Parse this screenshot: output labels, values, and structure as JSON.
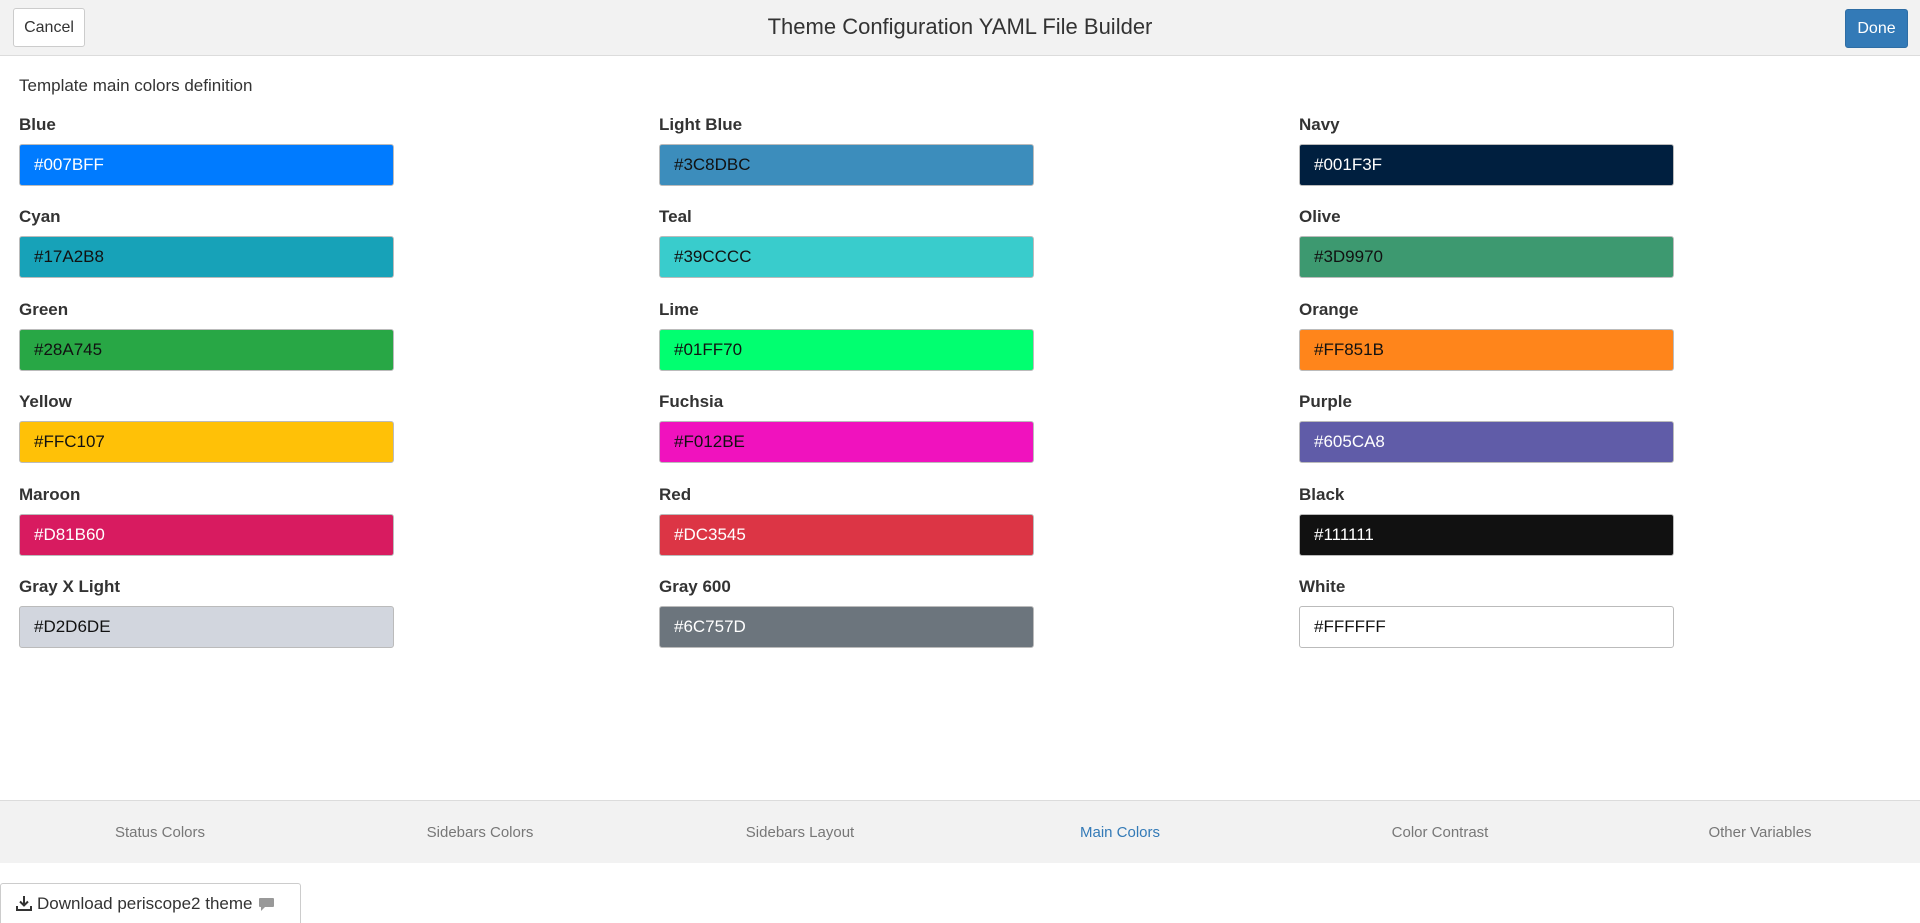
{
  "header": {
    "title": "Theme Configuration YAML File Builder",
    "cancel_label": "Cancel",
    "done_label": "Done"
  },
  "section": {
    "title": "Template main colors definition"
  },
  "colors": [
    {
      "label": "Blue",
      "value": "#007BFF",
      "bg": "#007BFF",
      "fg": "#FFFFFF"
    },
    {
      "label": "Light Blue",
      "value": "#3C8DBC",
      "bg": "#3C8DBC",
      "fg": "#111111"
    },
    {
      "label": "Navy",
      "value": "#001F3F",
      "bg": "#001F3F",
      "fg": "#FFFFFF"
    },
    {
      "label": "Cyan",
      "value": "#17A2B8",
      "bg": "#17A2B8",
      "fg": "#111111"
    },
    {
      "label": "Teal",
      "value": "#39CCCC",
      "bg": "#39CCCC",
      "fg": "#111111"
    },
    {
      "label": "Olive",
      "value": "#3D9970",
      "bg": "#3D9970",
      "fg": "#111111"
    },
    {
      "label": "Green",
      "value": "#28A745",
      "bg": "#28A745",
      "fg": "#111111"
    },
    {
      "label": "Lime",
      "value": "#01FF70",
      "bg": "#01FF70",
      "fg": "#111111"
    },
    {
      "label": "Orange",
      "value": "#FF851B",
      "bg": "#FF851B",
      "fg": "#111111"
    },
    {
      "label": "Yellow",
      "value": "#FFC107",
      "bg": "#FFC107",
      "fg": "#111111"
    },
    {
      "label": "Fuchsia",
      "value": "#F012BE",
      "bg": "#F012BE",
      "fg": "#111111"
    },
    {
      "label": "Purple",
      "value": "#605CA8",
      "bg": "#605CA8",
      "fg": "#FFFFFF"
    },
    {
      "label": "Maroon",
      "value": "#D81B60",
      "bg": "#D81B60",
      "fg": "#FFFFFF"
    },
    {
      "label": "Red",
      "value": "#DC3545",
      "bg": "#DC3545",
      "fg": "#FFFFFF"
    },
    {
      "label": "Black",
      "value": "#111111",
      "bg": "#111111",
      "fg": "#FFFFFF"
    },
    {
      "label": "Gray X Light",
      "value": "#D2D6DE",
      "bg": "#D2D6DE",
      "fg": "#111111"
    },
    {
      "label": "Gray 600",
      "value": "#6C757D",
      "bg": "#6C757D",
      "fg": "#FFFFFF"
    },
    {
      "label": "White",
      "value": "#FFFFFF",
      "bg": "#FFFFFF",
      "fg": "#111111"
    }
  ],
  "tabs": [
    {
      "label": "Status Colors",
      "active": false
    },
    {
      "label": "Sidebars Colors",
      "active": false
    },
    {
      "label": "Sidebars Layout",
      "active": false
    },
    {
      "label": "Main Colors",
      "active": true
    },
    {
      "label": "Color Contrast",
      "active": false
    },
    {
      "label": "Other Variables",
      "active": false
    }
  ],
  "download": {
    "label": "Download periscope2 theme",
    "icon": "download-icon",
    "trailing_icon": "comment-icon"
  },
  "accent": "#337ab7"
}
